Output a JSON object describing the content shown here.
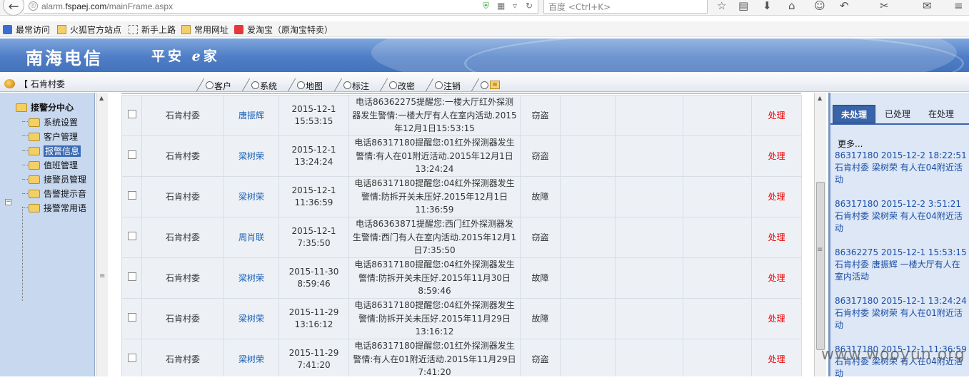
{
  "browser": {
    "url_prefix": "alarm.",
    "url_domain": "fspaej.com",
    "url_path": "/mainFrame.aspx",
    "search_placeholder": "百度 <Ctrl+K>"
  },
  "bookmarks": [
    "最常访问",
    "火狐官方站点",
    "新手上路",
    "常用网址",
    "爱淘宝（原淘宝特卖）"
  ],
  "banner": {
    "title": "南海电信",
    "slogan_a": "平安",
    "slogan_e": "e",
    "slogan_b": "家"
  },
  "navbar": {
    "village": "【 石肯村委",
    "tabs": [
      "客户",
      "系统",
      "地图",
      "标注",
      "改密",
      "注销"
    ]
  },
  "sidebar": {
    "root": "接警分中心",
    "items": [
      "系统设置",
      "客户管理",
      "报警信息",
      "值班管理",
      "接警员管理",
      "告警提示音",
      "接警常用语"
    ],
    "selected_index": 2
  },
  "alarm_table": {
    "rows": [
      {
        "org": "石肯村委",
        "user": "唐振辉",
        "date": "2015-12-1",
        "time": "15:53:15",
        "message": "电话86362275提醒您:一楼大厅红外探测器发生警情:一楼大厅有人在室内活动.2015年12月1日15:53:15",
        "type": "窃盗",
        "action": "处理"
      },
      {
        "org": "石肯村委",
        "user": "梁树荣",
        "date": "2015-12-1",
        "time": "13:24:24",
        "message": "电话86317180提醒您:01红外探测器发生警情:有人在01附近活动.2015年12月1日13:24:24",
        "type": "窃盗",
        "action": "处理"
      },
      {
        "org": "石肯村委",
        "user": "梁树荣",
        "date": "2015-12-1",
        "time": "11:36:59",
        "message": "电话86317180提醒您:04红外探测器发生警情:防拆开关未压好.2015年12月1日11:36:59",
        "type": "故障",
        "action": "处理"
      },
      {
        "org": "石肯村委",
        "user": "周肖联",
        "date": "2015-12-1",
        "time": "7:35:50",
        "message": "电话86363871提醒您:西门红外探测器发生警情:西门有人在室内活动.2015年12月1日7:35:50",
        "type": "窃盗",
        "action": "处理"
      },
      {
        "org": "石肯村委",
        "user": "梁树荣",
        "date": "2015-11-30",
        "time": "8:59:46",
        "message": "电话86317180提醒您:04红外探测器发生警情:防拆开关未压好.2015年11月30日8:59:46",
        "type": "故障",
        "action": "处理"
      },
      {
        "org": "石肯村委",
        "user": "梁树荣",
        "date": "2015-11-29",
        "time": "13:16:12",
        "message": "电话86317180提醒您:04红外探测器发生警情:防拆开关未压好.2015年11月29日13:16:12",
        "type": "故障",
        "action": "处理"
      },
      {
        "org": "石肯村委",
        "user": "梁树荣",
        "date": "2015-11-29",
        "time": "7:41:20",
        "message": "电话86317180提醒您:01红外探测器发生警情:有人在01附近活动.2015年11月29日7:41:20",
        "type": "窃盗",
        "action": "处理"
      }
    ]
  },
  "right_panel": {
    "tabs": [
      "未处理",
      "已处理",
      "在处理"
    ],
    "active_tab": 0,
    "more": "更多...",
    "alarms": [
      {
        "line1": "86317180  2015-12-2 18:22:51",
        "line2": "石肯村委 梁树荣 有人在04附近活动"
      },
      {
        "line1": "86317180  2015-12-2 3:51:21",
        "line2": "石肯村委 梁树荣 有人在04附近活动"
      },
      {
        "line1": "86362275  2015-12-1 15:53:15",
        "line2": "石肯村委 唐振辉 一楼大厅有人在室内活动"
      },
      {
        "line1": "86317180  2015-12-1 13:24:24",
        "line2": "石肯村委 梁树荣 有人在01附近活动"
      },
      {
        "line1": "86317180  2015-12-1 11:36:59",
        "line2": "石肯村委 梁树荣 有人在04附近活动"
      }
    ]
  },
  "watermark": "www.wooyun.org",
  "colors": {
    "accent": "#3a64a8",
    "action": "#ee0000",
    "link": "#1a5fb4",
    "banner": "#4f7ec6"
  }
}
